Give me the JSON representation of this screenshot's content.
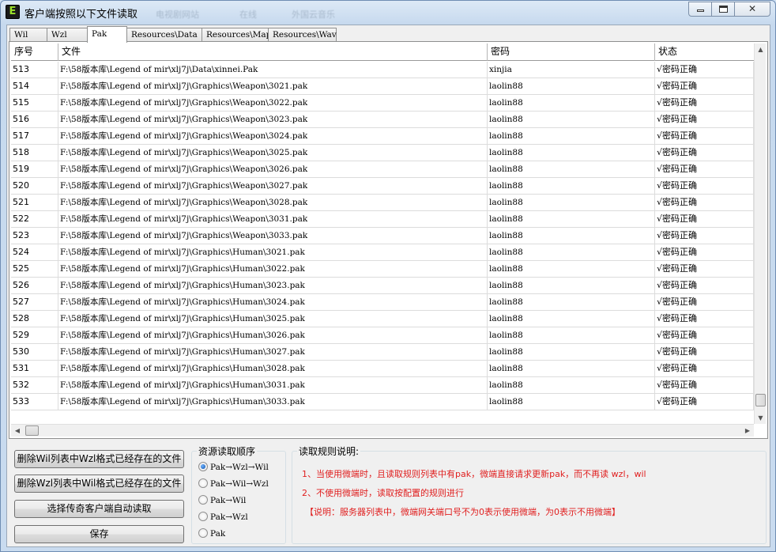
{
  "window": {
    "title": "客户端按照以下文件读取",
    "ghost_menu": [
      "电视剧网站",
      "在线",
      "外国云音乐"
    ],
    "icon_letter": "E",
    "maximize_glyph": "",
    "close_glyph": "✕"
  },
  "tabs": [
    {
      "label": "Wil",
      "active": false
    },
    {
      "label": "Wzl",
      "active": false
    },
    {
      "label": "Pak",
      "active": true
    },
    {
      "label": "Resources\\Data",
      "active": false
    },
    {
      "label": "Resources\\Map",
      "active": false
    },
    {
      "label": "Resources\\Wav",
      "active": false
    }
  ],
  "table": {
    "columns": [
      "序号",
      "文件",
      "密码",
      "状态"
    ],
    "rows": [
      {
        "num": "513",
        "file": "F:\\58版本库\\Legend of mir\\xlj7j\\Data\\xinnei.Pak",
        "password": "xinjia",
        "status": "√密码正确"
      },
      {
        "num": "514",
        "file": "F:\\58版本库\\Legend of mir\\xlj7j\\Graphics\\Weapon\\3021.pak",
        "password": "laolin88",
        "status": "√密码正确"
      },
      {
        "num": "515",
        "file": "F:\\58版本库\\Legend of mir\\xlj7j\\Graphics\\Weapon\\3022.pak",
        "password": "laolin88",
        "status": "√密码正确"
      },
      {
        "num": "516",
        "file": "F:\\58版本库\\Legend of mir\\xlj7j\\Graphics\\Weapon\\3023.pak",
        "password": "laolin88",
        "status": "√密码正确"
      },
      {
        "num": "517",
        "file": "F:\\58版本库\\Legend of mir\\xlj7j\\Graphics\\Weapon\\3024.pak",
        "password": "laolin88",
        "status": "√密码正确"
      },
      {
        "num": "518",
        "file": "F:\\58版本库\\Legend of mir\\xlj7j\\Graphics\\Weapon\\3025.pak",
        "password": "laolin88",
        "status": "√密码正确"
      },
      {
        "num": "519",
        "file": "F:\\58版本库\\Legend of mir\\xlj7j\\Graphics\\Weapon\\3026.pak",
        "password": "laolin88",
        "status": "√密码正确"
      },
      {
        "num": "520",
        "file": "F:\\58版本库\\Legend of mir\\xlj7j\\Graphics\\Weapon\\3027.pak",
        "password": "laolin88",
        "status": "√密码正确"
      },
      {
        "num": "521",
        "file": "F:\\58版本库\\Legend of mir\\xlj7j\\Graphics\\Weapon\\3028.pak",
        "password": "laolin88",
        "status": "√密码正确"
      },
      {
        "num": "522",
        "file": "F:\\58版本库\\Legend of mir\\xlj7j\\Graphics\\Weapon\\3031.pak",
        "password": "laolin88",
        "status": "√密码正确"
      },
      {
        "num": "523",
        "file": "F:\\58版本库\\Legend of mir\\xlj7j\\Graphics\\Weapon\\3033.pak",
        "password": "laolin88",
        "status": "√密码正确"
      },
      {
        "num": "524",
        "file": "F:\\58版本库\\Legend of mir\\xlj7j\\Graphics\\Human\\3021.pak",
        "password": "laolin88",
        "status": "√密码正确"
      },
      {
        "num": "525",
        "file": "F:\\58版本库\\Legend of mir\\xlj7j\\Graphics\\Human\\3022.pak",
        "password": "laolin88",
        "status": "√密码正确"
      },
      {
        "num": "526",
        "file": "F:\\58版本库\\Legend of mir\\xlj7j\\Graphics\\Human\\3023.pak",
        "password": "laolin88",
        "status": "√密码正确"
      },
      {
        "num": "527",
        "file": "F:\\58版本库\\Legend of mir\\xlj7j\\Graphics\\Human\\3024.pak",
        "password": "laolin88",
        "status": "√密码正确"
      },
      {
        "num": "528",
        "file": "F:\\58版本库\\Legend of mir\\xlj7j\\Graphics\\Human\\3025.pak",
        "password": "laolin88",
        "status": "√密码正确"
      },
      {
        "num": "529",
        "file": "F:\\58版本库\\Legend of mir\\xlj7j\\Graphics\\Human\\3026.pak",
        "password": "laolin88",
        "status": "√密码正确"
      },
      {
        "num": "530",
        "file": "F:\\58版本库\\Legend of mir\\xlj7j\\Graphics\\Human\\3027.pak",
        "password": "laolin88",
        "status": "√密码正确"
      },
      {
        "num": "531",
        "file": "F:\\58版本库\\Legend of mir\\xlj7j\\Graphics\\Human\\3028.pak",
        "password": "laolin88",
        "status": "√密码正确"
      },
      {
        "num": "532",
        "file": "F:\\58版本库\\Legend of mir\\xlj7j\\Graphics\\Human\\3031.pak",
        "password": "laolin88",
        "status": "√密码正确"
      },
      {
        "num": "533",
        "file": "F:\\58版本库\\Legend of mir\\xlj7j\\Graphics\\Human\\3033.pak",
        "password": "laolin88",
        "status": "√密码正确"
      }
    ]
  },
  "buttons": {
    "delete_wil": "删除Wil列表中Wzl格式已经存在的文件",
    "delete_wzl": "删除Wzl列表中Wil格式已经存在的文件",
    "auto_read": "选择传奇客户端自动读取",
    "save": "保存"
  },
  "read_order": {
    "title": "资源读取顺序",
    "selected": 0,
    "options": [
      "Pak→Wzl→Wil",
      "Pak→Wil→Wzl",
      "Pak→Wil",
      "Pak→Wzl",
      "Pak"
    ]
  },
  "rules": {
    "title": "读取规则说明:",
    "line1": "1、当使用微端时，且读取规则列表中有pak，微端直接请求更新pak，而不再读 wzl，wil",
    "line2": "2、不使用微端时，读取按配置的规则进行",
    "note": "【说明：服务器列表中，微端网关端口号不为0表示使用微端，为0表示不用微端】"
  },
  "colors": {
    "rules_text": "#e02020",
    "radio_selected": "#0b4fa8"
  }
}
